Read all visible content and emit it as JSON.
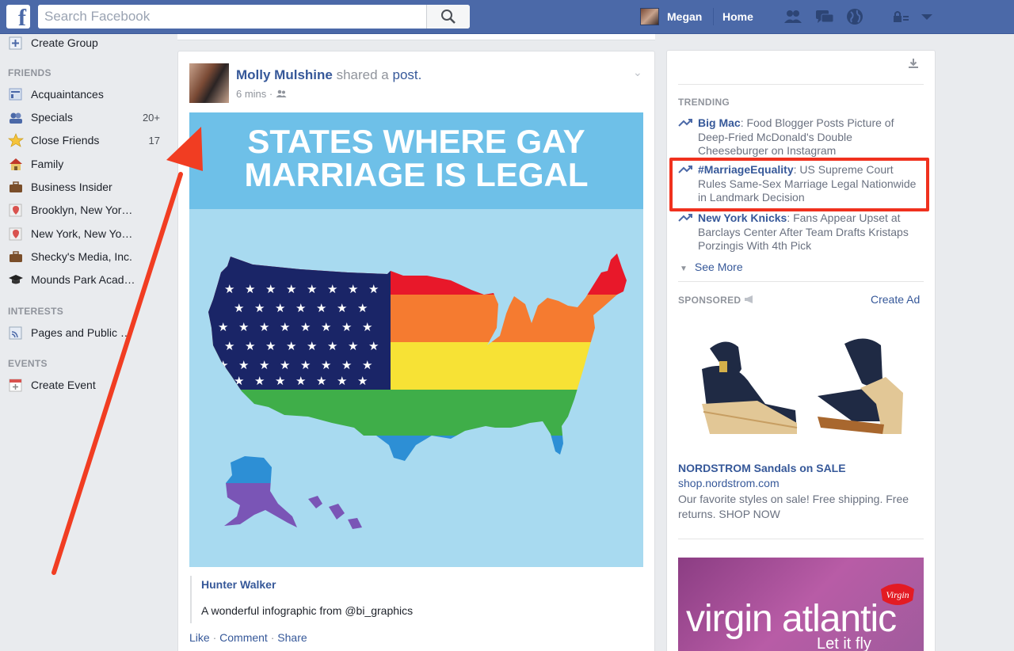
{
  "topbar": {
    "logo": "f",
    "search_placeholder": "Search Facebook",
    "user_name": "Megan",
    "home_label": "Home"
  },
  "icons": {
    "search": "search-icon",
    "friends": "friend-requests-icon",
    "messages": "messages-icon",
    "notifications": "globe-icon",
    "privacy": "privacy-icon",
    "menu": "chevron-down-icon"
  },
  "sidebar": {
    "create_group": "Create Group",
    "friends_heading": "FRIENDS",
    "friends": [
      {
        "label": "Acquaintances",
        "count": ""
      },
      {
        "label": "Specials",
        "count": "20+"
      },
      {
        "label": "Close Friends",
        "count": "17"
      },
      {
        "label": "Family",
        "count": ""
      },
      {
        "label": "Business Insider",
        "count": ""
      },
      {
        "label": "Brooklyn, New Yor…",
        "count": ""
      },
      {
        "label": "New York, New Yo…",
        "count": ""
      },
      {
        "label": "Shecky's Media, Inc.",
        "count": ""
      },
      {
        "label": "Mounds Park Acad…",
        "count": ""
      }
    ],
    "interests_heading": "INTERESTS",
    "interests_item": "Pages and Public …",
    "events_heading": "EVENTS",
    "events_item": "Create Event"
  },
  "post": {
    "author": "Molly Mulshine",
    "action": "shared a",
    "object": "post.",
    "time": "6 mins",
    "image_title_line1": "STATES WHERE GAY",
    "image_title_line2": "MARRIAGE IS LEGAL",
    "shared_author": "Hunter Walker",
    "shared_text": "A wonderful infographic from @bi_graphics",
    "like": "Like",
    "comment": "Comment",
    "share": "Share"
  },
  "trending": {
    "heading": "TRENDING",
    "items": [
      {
        "topic": "Big Mac",
        "text": "Food Blogger Posts Picture of Deep-Fried McDonald's Double Cheeseburger on Instagram"
      },
      {
        "topic": "#MarriageEquality",
        "text": "US Supreme Court Rules Same-Sex Marriage Legal Nationwide in Landmark Decision"
      },
      {
        "topic": "New York Knicks",
        "text": "Fans Appear Upset at Barclays Center After Team Drafts Kristaps Porzingis With 4th Pick"
      }
    ],
    "see_more": "See More"
  },
  "sponsored": {
    "heading": "SPONSORED",
    "create_ad": "Create Ad",
    "ad_title": "NORDSTROM Sandals on SALE",
    "ad_url": "shop.nordstrom.com",
    "ad_desc": "Our favorite styles on sale! Free shipping. Free returns. SHOP NOW",
    "ad2_text": "virgin atlantic",
    "ad2_tag": "Let it fly",
    "ad2_logo": "Virgin"
  },
  "colors": {
    "facebook_blue": "#4b69a8",
    "link_blue": "#365899",
    "highlight_red": "#f0311e",
    "annotation_red": "#f13d22"
  }
}
